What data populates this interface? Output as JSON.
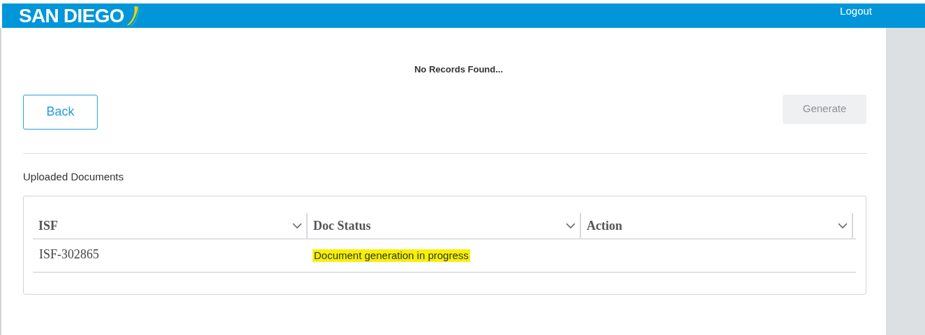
{
  "header": {
    "logo": "SAN DIEGO",
    "logout": "Logout"
  },
  "message": "No Records Found...",
  "buttons": [
    {
      "kind": "back",
      "label": "Back",
      "disabled": false
    },
    {
      "kind": "generate",
      "label": "Generate",
      "disabled": true
    }
  ],
  "section_title": "Uploaded Documents",
  "table": {
    "columns": [
      "ISF",
      "Doc Status",
      "Action"
    ],
    "rows": [
      {
        "cells": [
          "ISF-302865",
          "Document generation in progress",
          ""
        ],
        "highlighted": true
      }
    ]
  }
}
